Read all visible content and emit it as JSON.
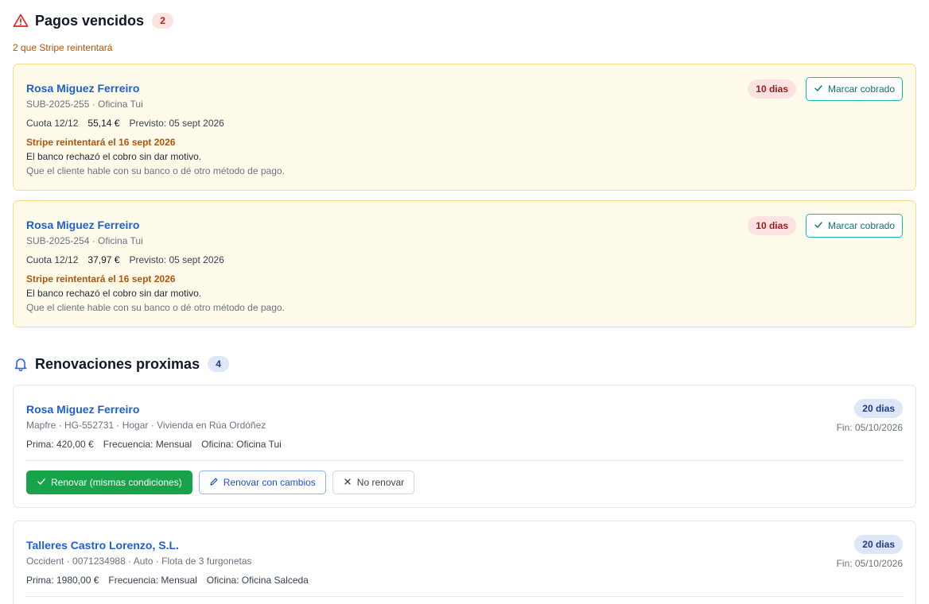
{
  "overdue": {
    "title": "Pagos vencidos",
    "count": "2",
    "note": "2 que Stripe reintentará",
    "items": [
      {
        "client": "Rosa Miguez Ferreiro",
        "meta": "SUB-2025-255 · Oficina Tui",
        "installment": "Cuota 12/12",
        "amount": "55,14 €",
        "expected": "Previsto: 05 sept 2026",
        "retry": "Stripe reintentará el 16 sept 2026",
        "reason": "El banco rechazó el cobro sin dar motivo.",
        "hint": "Que el cliente hable con su banco o dé otro método de pago.",
        "days": "10 dias",
        "action": "Marcar cobrado"
      },
      {
        "client": "Rosa Miguez Ferreiro",
        "meta": "SUB-2025-254 · Oficina Tui",
        "installment": "Cuota 12/12",
        "amount": "37,97 €",
        "expected": "Previsto: 05 sept 2026",
        "retry": "Stripe reintentará el 16 sept 2026",
        "reason": "El banco rechazó el cobro sin dar motivo.",
        "hint": "Que el cliente hable con su banco o dé otro método de pago.",
        "days": "10 dias",
        "action": "Marcar cobrado"
      }
    ]
  },
  "renewals": {
    "title": "Renovaciones proximas",
    "count": "4",
    "items": [
      {
        "client": "Rosa Miguez Ferreiro",
        "meta": "Mapfre · HG-552731 · Hogar · Vivienda en Rúa Ordóñez",
        "premium": "Prima: 420,00 €",
        "frequency": "Frecuencia: Mensual",
        "office": "Oficina: Oficina Tui",
        "days": "20 dias",
        "end": "Fin: 05/10/2026",
        "renew_same": "Renovar (mismas condiciones)",
        "renew_changes": "Renovar con cambios",
        "no_renew": "No renovar"
      },
      {
        "client": "Talleres Castro Lorenzo, S.L.",
        "meta": "Occident · 0071234988 · Auto · Flota de 3 furgonetas",
        "premium": "Prima: 1980,00 €",
        "frequency": "Frecuencia: Mensual",
        "office": "Oficina: Oficina Salceda",
        "days": "20 dias",
        "end": "Fin: 05/10/2026"
      }
    ]
  },
  "icons": {
    "overdue": "warning-triangle-icon",
    "renewals": "bell-icon",
    "check": "check-icon",
    "edit": "pencil-icon",
    "close": "x-icon"
  },
  "colors": {
    "link": "#1d5fd6",
    "warning_bg": "#fffbeb",
    "warning_border": "#f7df8b",
    "danger": "#dc2626",
    "teal": "#14b8a6",
    "green": "#16a34a"
  }
}
